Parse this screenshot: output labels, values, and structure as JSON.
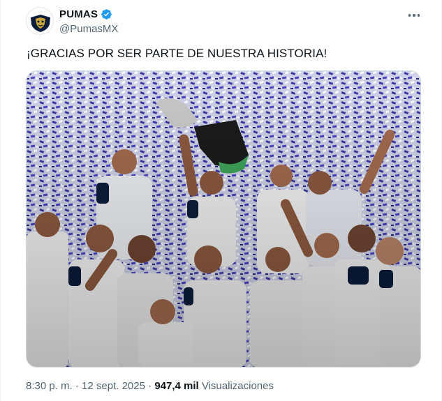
{
  "account": {
    "name": "PUMAS",
    "handle": "@PumasMX",
    "verified_color": "#1d9bf0"
  },
  "tweet": {
    "text": "¡GRACIAS POR SER PARTE DE NUESTRA HISTORIA!",
    "time": "8:30 p. m.",
    "separator": " · ",
    "date": "12 sept. 2025",
    "separator2": " · ",
    "views_count": "947,4 mil",
    "views_label": " Visualizaciones"
  },
  "icons": {
    "more": "more-options-icon",
    "verified": "verified-badge-icon"
  },
  "colors": {
    "text_primary": "#0f1419",
    "text_secondary": "#536471",
    "confetti": "#3d3aa6"
  }
}
